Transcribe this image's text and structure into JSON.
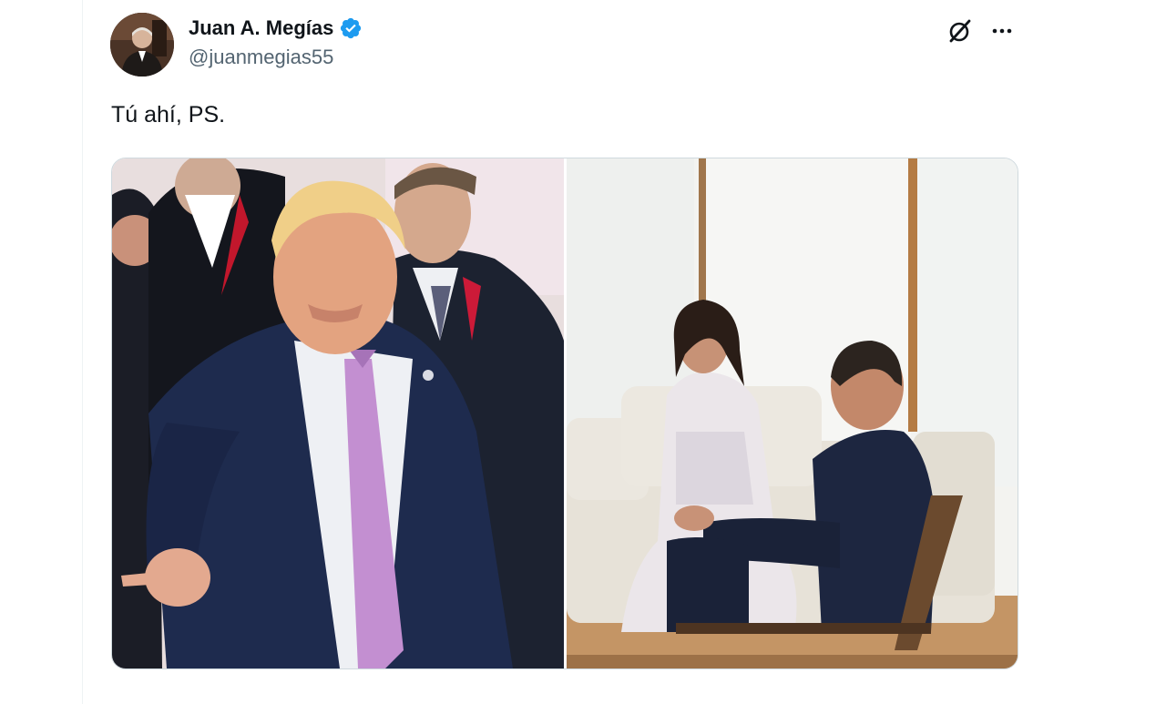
{
  "tweet": {
    "author": {
      "display_name": "Juan A. Megías",
      "handle": "@juanmegias55",
      "verified": true,
      "avatar_icon": "profile-photo"
    },
    "text": "Tú ahí, PS.",
    "header_actions": {
      "grok_icon": "grok-icon",
      "more_icon": "more-horizontal-icon"
    },
    "media": [
      {
        "kind": "photo",
        "icon": "photo-man-pointing"
      },
      {
        "kind": "photo",
        "icon": "photo-couple-seated-conversation"
      }
    ]
  },
  "colors": {
    "verified_blue": "#1d9bf0",
    "text_primary": "#0f1419",
    "text_secondary": "#536471",
    "border": "#cfd9de"
  }
}
